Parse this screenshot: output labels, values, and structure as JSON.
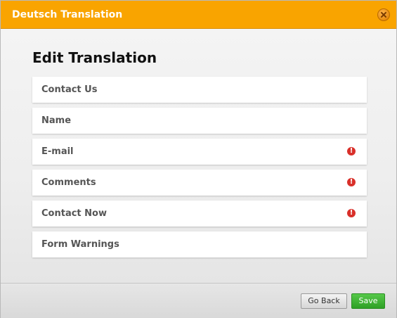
{
  "window": {
    "title": "Deutsch Translation",
    "titlebar_color": "#f9a400"
  },
  "main": {
    "heading": "Edit Translation",
    "items": [
      {
        "label": "Contact Us",
        "warning": false
      },
      {
        "label": "Name",
        "warning": false
      },
      {
        "label": "E-mail",
        "warning": true,
        "icon": "warning-icon"
      },
      {
        "label": "Comments",
        "warning": true,
        "icon": "warning-icon"
      },
      {
        "label": "Contact Now",
        "warning": true,
        "icon": "warning-icon"
      },
      {
        "label": "Form Warnings",
        "warning": false
      }
    ]
  },
  "footer": {
    "back_label": "Go Back",
    "save_label": "Save",
    "save_color": "#3fb534"
  },
  "icons": {
    "close": "close-icon",
    "warning": "warning-icon"
  }
}
